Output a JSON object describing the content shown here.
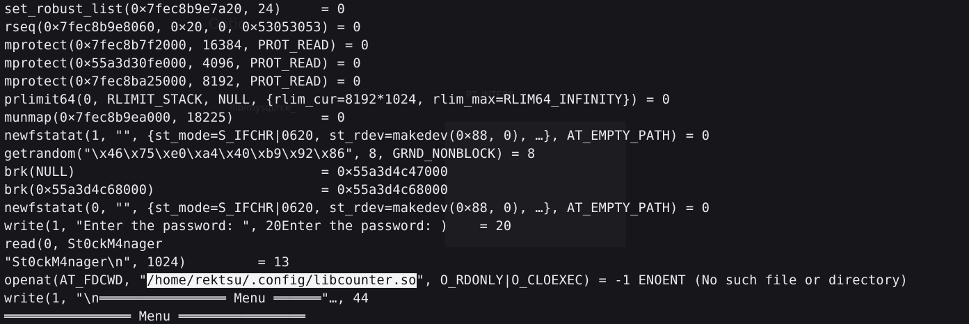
{
  "terminal": {
    "lines": [
      "set_robust_list(0×7fec8b9e7a20, 24)     = 0",
      "rseq(0×7fec8b9e8060, 0×20, 0, 0×53053053) = 0",
      "mprotect(0×7fec8b7f2000, 16384, PROT_READ) = 0",
      "mprotect(0×55a3d30fe000, 4096, PROT_READ) = 0",
      "mprotect(0×7fec8ba25000, 8192, PROT_READ) = 0",
      "prlimit64(0, RLIMIT_STACK, NULL, {rlim_cur=8192*1024, rlim_max=RLIM64_INFINITY}) = 0",
      "munmap(0×7fec8b9ea000, 18225)           = 0",
      "newfstatat(1, \"\", {st_mode=S_IFCHR|0620, st_rdev=makedev(0×88, 0), …}, AT_EMPTY_PATH) = 0",
      "getrandom(\"\\x46\\x75\\xe0\\xa4\\x40\\xb9\\x92\\x86\", 8, GRND_NONBLOCK) = 8",
      "brk(NULL)                               = 0×55a3d4c47000",
      "brk(0×55a3d4c68000)                     = 0×55a3d4c68000",
      "newfstatat(0, \"\", {st_mode=S_IFCHR|0620, st_rdev=makedev(0×88, 0), …}, AT_EMPTY_PATH) = 0",
      "write(1, \"Enter the password: \", 20Enter the password: )    = 20",
      "read(0, St0ckM4nager",
      "\"St0ckM4nager\\n\", 1024)         = 13"
    ],
    "openat_line": {
      "prefix": "openat(AT_FDCWD, \"",
      "selected": "/home/rektsu/.config/libcounter.so",
      "suffix": "\", O_RDONLY|O_CLOEXEC) = -1 ENOENT (No such file or directory)"
    },
    "tail_lines": [
      "write(1, \"\\n════════════════ Menu ══════\"…, 44",
      "════════════════ Menu ════════════════"
    ]
  },
  "background_ghost": {
    "text_1": "Optio",
    "text_2": "/lib/mysql/rce_",
    "text_3": "PT_INTERP"
  }
}
